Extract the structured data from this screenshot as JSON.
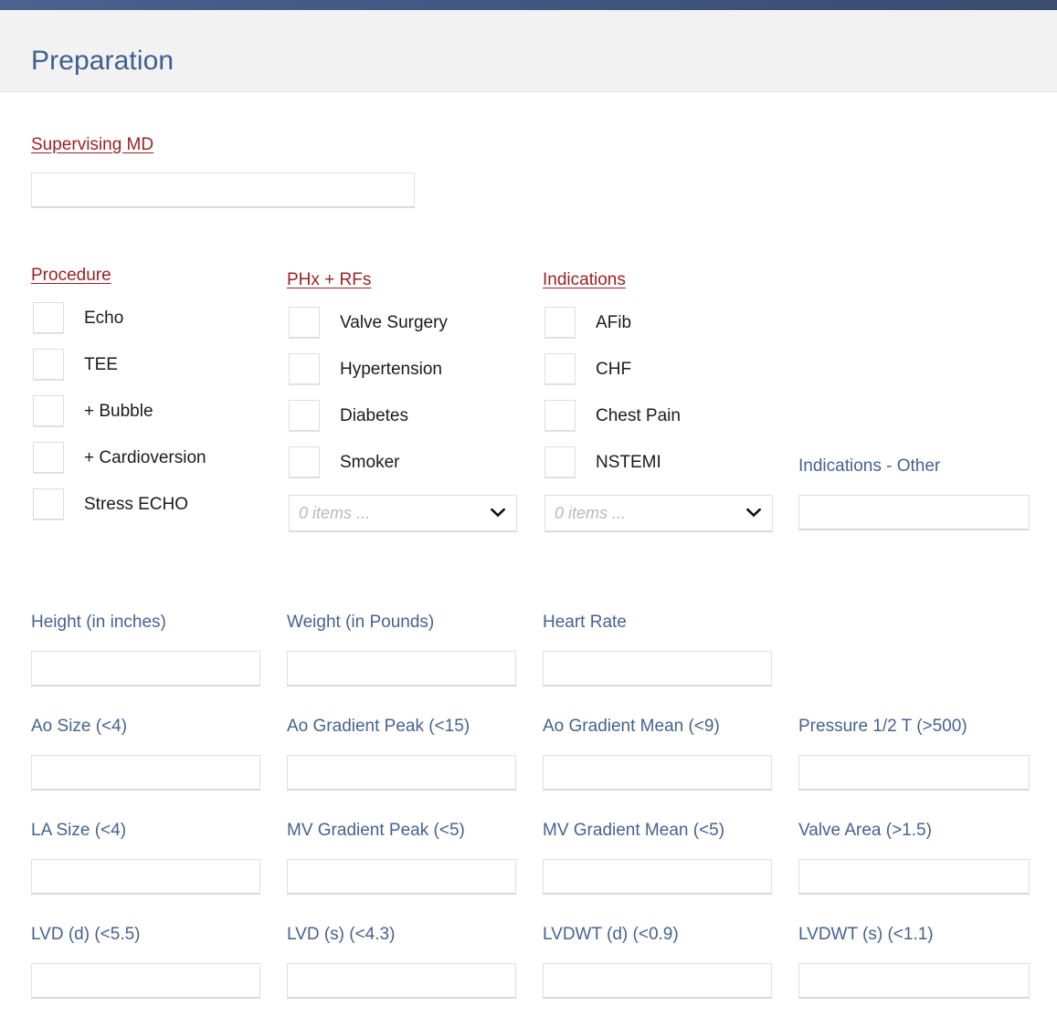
{
  "header": {
    "title": "Preparation",
    "accent_bar_color_left": "#4a628f",
    "accent_bar_color_right": "#3b4c70",
    "background": "#f2f2f2",
    "title_color": "#3f5f8f"
  },
  "colors": {
    "link_red": "#9c2123",
    "label_blue": "#45638f",
    "input_border": "#e0e0e0",
    "checkbox_border": "#dedede",
    "page_background": "#ffffff"
  },
  "supervising_md": {
    "label": "Supervising MD",
    "value": "",
    "placeholder": ""
  },
  "groups": [
    {
      "key": "procedure",
      "label": "Procedure",
      "options": [
        {
          "label": "Echo",
          "checked": false
        },
        {
          "label": "TEE",
          "checked": false
        },
        {
          "label": "+ Bubble",
          "checked": false
        },
        {
          "label": "+ Cardioversion",
          "checked": false
        },
        {
          "label": "Stress ECHO",
          "checked": false
        }
      ],
      "has_multiselect": false
    },
    {
      "key": "phx_rfs",
      "label": "PHx + RFs",
      "options": [
        {
          "label": "Valve Surgery",
          "checked": false
        },
        {
          "label": "Hypertension",
          "checked": false
        },
        {
          "label": "Diabetes",
          "checked": false
        },
        {
          "label": "Smoker",
          "checked": false
        }
      ],
      "has_multiselect": true,
      "multiselect_text": "0 items ..."
    },
    {
      "key": "indications",
      "label": "Indications",
      "options": [
        {
          "label": "AFib",
          "checked": false
        },
        {
          "label": "CHF",
          "checked": false
        },
        {
          "label": "Chest Pain",
          "checked": false
        },
        {
          "label": "NSTEMI",
          "checked": false
        }
      ],
      "has_multiselect": true,
      "multiselect_text": "0 items ..."
    }
  ],
  "indications_other": {
    "label": "Indications - Other",
    "value": "",
    "placeholder": ""
  },
  "measurements": [
    {
      "key": "height",
      "label": "Height (in inches)",
      "value": "",
      "placeholder": ""
    },
    {
      "key": "weight",
      "label": "Weight (in Pounds)",
      "value": "",
      "placeholder": ""
    },
    {
      "key": "heart_rate",
      "label": "Heart Rate",
      "value": "",
      "placeholder": ""
    },
    {
      "key": "ao_size",
      "label": "Ao Size (<4)",
      "value": "",
      "placeholder": ""
    },
    {
      "key": "ao_grad_peak",
      "label": "Ao Gradient Peak (<15)",
      "value": "",
      "placeholder": ""
    },
    {
      "key": "ao_grad_mean",
      "label": "Ao Gradient Mean (<9)",
      "value": "",
      "placeholder": ""
    },
    {
      "key": "pressure_half_t",
      "label": "Pressure 1/2 T (>500)",
      "value": "",
      "placeholder": ""
    },
    {
      "key": "la_size",
      "label": "LA Size (<4)",
      "value": "",
      "placeholder": ""
    },
    {
      "key": "mv_grad_peak",
      "label": "MV Gradient Peak (<5)",
      "value": "",
      "placeholder": ""
    },
    {
      "key": "mv_grad_mean",
      "label": "MV Gradient Mean (<5)",
      "value": "",
      "placeholder": ""
    },
    {
      "key": "valve_area",
      "label": "Valve Area (>1.5)",
      "value": "",
      "placeholder": ""
    },
    {
      "key": "lvd_d",
      "label": "LVD (d) (<5.5)",
      "value": "",
      "placeholder": ""
    },
    {
      "key": "lvd_s",
      "label": "LVD (s) (<4.3)",
      "value": "",
      "placeholder": ""
    },
    {
      "key": "lvdwt_d",
      "label": "LVDWT (d) (<0.9)",
      "value": "",
      "placeholder": ""
    },
    {
      "key": "lvdwt_s",
      "label": "LVDWT (s) (<1.1)",
      "value": "",
      "placeholder": ""
    }
  ],
  "icons": {
    "dropdown": "chevron-down-icon"
  }
}
